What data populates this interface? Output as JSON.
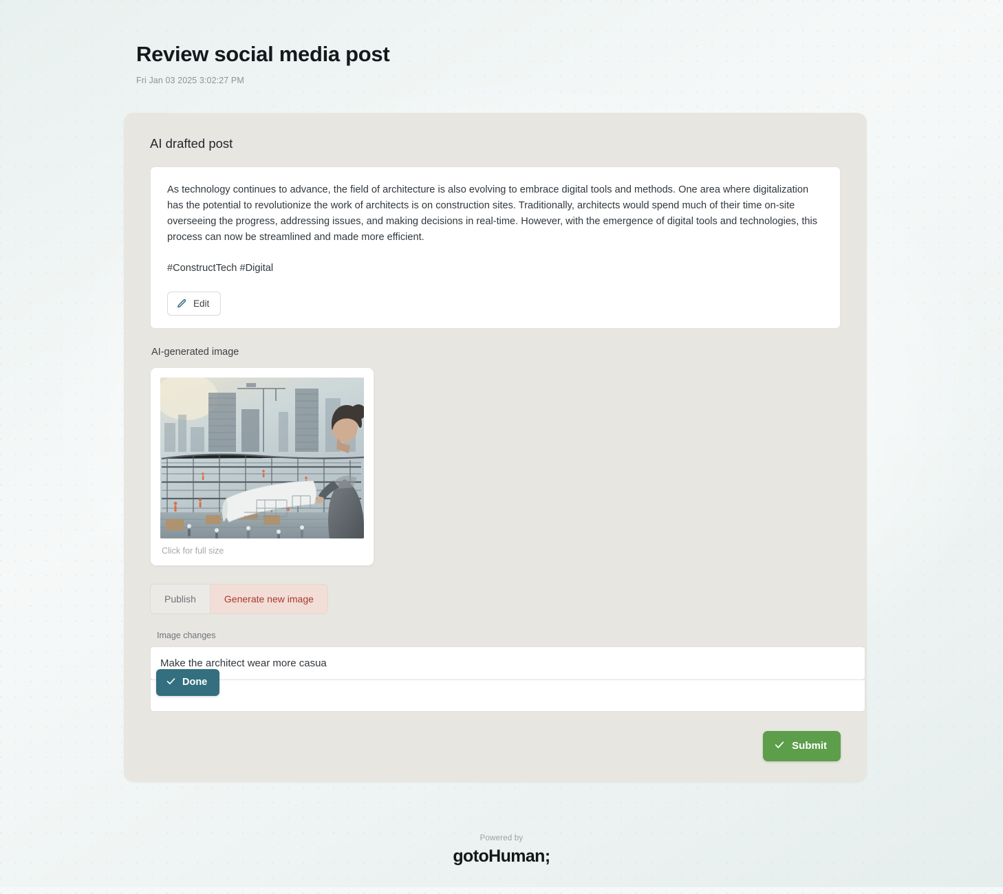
{
  "header": {
    "title": "Review social media post",
    "timestamp": "Fri Jan 03 2025 3:02:27 PM"
  },
  "card": {
    "section_title": "AI drafted post",
    "post_body": "As technology continues to advance, the field of architecture is also evolving to embrace digital tools and methods. One area where digitalization has the potential to revolutionize the work of architects is on construction sites. Traditionally, architects would spend much of their time on-site overseeing the progress, addressing issues, and making decisions in real-time. However, with the emergence of digital tools and technologies, this process can now be streamlined and made more efficient.",
    "post_hashtags": "#ConstructTech #Digital",
    "edit_label": "Edit",
    "edit_icon": "pencil-icon",
    "image_section_label": "AI-generated image",
    "image_caption": "Click for full size",
    "image_alt": "AI generated illustration of an architect reviewing blueprints at a steel-frame construction site with city skyline",
    "segmented": {
      "options": [
        {
          "label": "Publish",
          "active": false
        },
        {
          "label": "Generate new image",
          "active": true
        }
      ]
    },
    "changes": {
      "label": "Image changes",
      "value": "Make the architect wear more casua",
      "placeholder": ""
    },
    "done_label": "Done",
    "done_icon": "check-icon",
    "submit_label": "Submit",
    "submit_icon": "check-icon"
  },
  "footer": {
    "powered_by": "Powered by",
    "brand": "gotoHuman;"
  },
  "colors": {
    "page_background": "#f5f8f8",
    "card_background": "#e8e6e1",
    "panel_background": "#ffffff",
    "accent_active_tab_bg": "#f2ded7",
    "accent_active_tab_text": "#a8392a",
    "done_button": "#336f7e",
    "submit_button": "#5c9e4a",
    "title_text": "#16191c",
    "muted_text": "#8d9396"
  }
}
